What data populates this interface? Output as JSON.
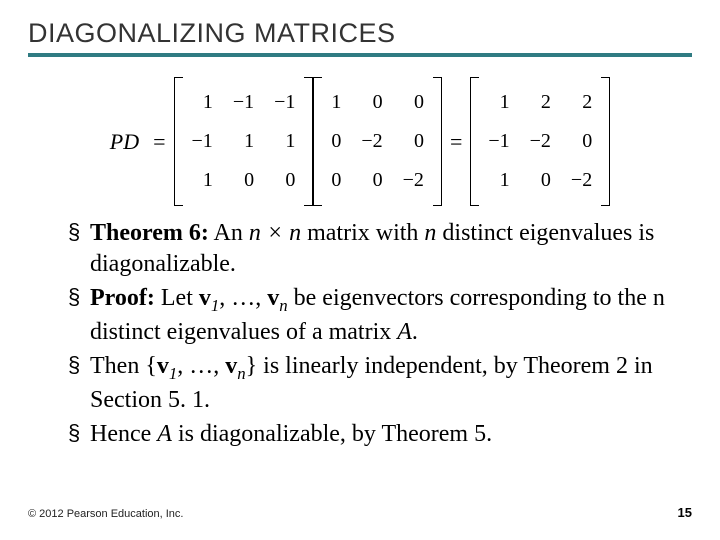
{
  "title": "DIAGONALIZING MATRICES",
  "equation": {
    "lhs": "PD",
    "mat1": [
      [
        "1",
        "−1",
        "−1"
      ],
      [
        "−1",
        "1",
        "1"
      ],
      [
        "1",
        "0",
        "0"
      ]
    ],
    "mat2": [
      [
        "1",
        "0",
        "0"
      ],
      [
        "0",
        "−2",
        "0"
      ],
      [
        "0",
        "0",
        "−2"
      ]
    ],
    "mat3": [
      [
        "1",
        "2",
        "2"
      ],
      [
        "−1",
        "−2",
        "0"
      ],
      [
        "1",
        "0",
        "−2"
      ]
    ]
  },
  "bullets": {
    "b1_prefix": "Theorem 6:",
    "b1_mid1": " An ",
    "b1_nxn": "n × n",
    "b1_mid2": " matrix with ",
    "b1_n": "n",
    "b1_rest": " distinct eigenvalues is diagonalizable.",
    "b2_prefix": "Proof:",
    "b2_text": " Let ",
    "b2_v1": "v",
    "b2_s1": "1",
    "b2_dots": ", …, ",
    "b2_vn": "v",
    "b2_sn": "n",
    "b2_rest": " be eigenvectors corresponding to the n distinct eigenvalues of a matrix ",
    "b2_A": "A",
    "b2_period": ".",
    "b3_text1": "Then {",
    "b3_v1": "v",
    "b3_s1": "1",
    "b3_dots": ", …, ",
    "b3_vn": "v",
    "b3_sn": "n",
    "b3_text2": "} is linearly independent, by Theorem 2 in Section 5. 1.",
    "b4": "Hence ",
    "b4_A": "A",
    "b4_rest": " is diagonalizable, by Theorem 5."
  },
  "footer": {
    "copyright": "© 2012 Pearson Education, Inc.",
    "page": "15"
  }
}
